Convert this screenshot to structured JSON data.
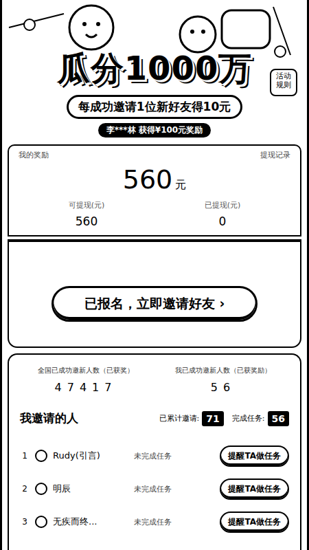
{
  "hero": {
    "title": "瓜分1000万",
    "subtitle": "每成功邀请1位新好友得10元",
    "ticker": "李***林 获得¥100元奖励",
    "rules": "活动规则"
  },
  "reward_card": {
    "header_left": "我的奖励",
    "header_right": "提现记录",
    "total": "560",
    "unit": "元",
    "stats": [
      {
        "label": "可提现(元)",
        "value": "560"
      },
      {
        "label": "已提现(元)",
        "value": "0"
      }
    ]
  },
  "cta": {
    "label": "已报名，立即邀请好友",
    "arrow": "›"
  },
  "counters": [
    {
      "label": "全国已成功邀新人数（已获奖）",
      "value": "47417"
    },
    {
      "label": "我已成功邀新人数（已获奖励）",
      "value": "56"
    }
  ],
  "invites": {
    "title": "我邀请的人",
    "summary": [
      {
        "label": "已累计邀请:",
        "value": "71"
      },
      {
        "label": "完成任务:",
        "value": "56"
      }
    ],
    "rows": [
      {
        "rank": "1",
        "name": "Rudy(引言)",
        "status": "未完成任务",
        "action": "提醒TA做任务"
      },
      {
        "rank": "2",
        "name": "明辰",
        "status": "未完成任务",
        "action": "提醒TA做任务"
      },
      {
        "rank": "3",
        "name": "无疾而终...",
        "status": "未完成任务",
        "action": "提醒TA做任务"
      }
    ]
  }
}
